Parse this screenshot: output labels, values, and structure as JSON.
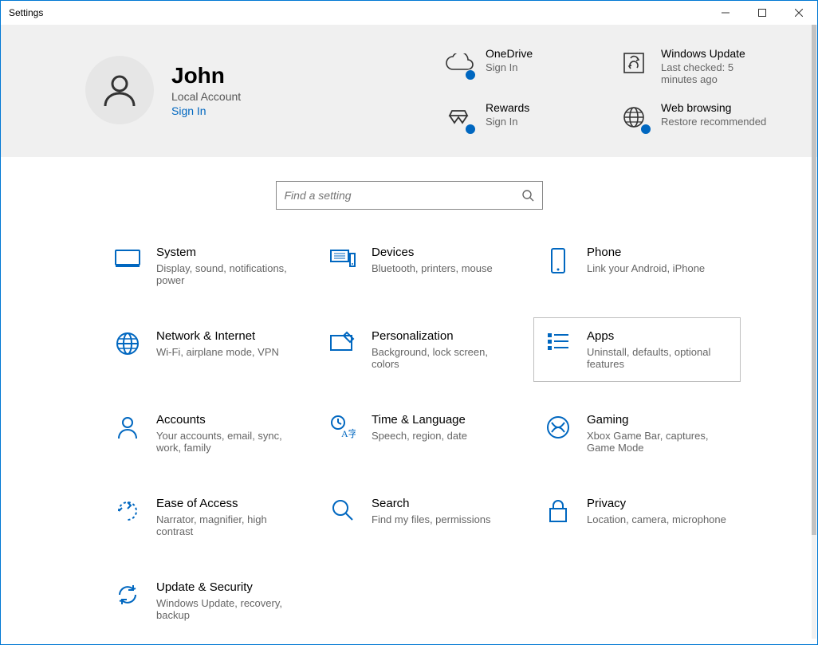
{
  "window": {
    "title": "Settings"
  },
  "account": {
    "name": "John",
    "type": "Local Account",
    "signin": "Sign In"
  },
  "header_tiles": {
    "onedrive": {
      "title": "OneDrive",
      "sub": "Sign In"
    },
    "rewards": {
      "title": "Rewards",
      "sub": "Sign In"
    },
    "windows_update": {
      "title": "Windows Update",
      "sub": "Last checked: 5 minutes ago"
    },
    "web_browsing": {
      "title": "Web browsing",
      "sub": "Restore recommended"
    }
  },
  "search": {
    "placeholder": "Find a setting"
  },
  "categories": {
    "system": {
      "title": "System",
      "desc": "Display, sound, notifications, power"
    },
    "devices": {
      "title": "Devices",
      "desc": "Bluetooth, printers, mouse"
    },
    "phone": {
      "title": "Phone",
      "desc": "Link your Android, iPhone"
    },
    "network": {
      "title": "Network & Internet",
      "desc": "Wi-Fi, airplane mode, VPN"
    },
    "personalization": {
      "title": "Personalization",
      "desc": "Background, lock screen, colors"
    },
    "apps": {
      "title": "Apps",
      "desc": "Uninstall, defaults, optional features"
    },
    "accounts": {
      "title": "Accounts",
      "desc": "Your accounts, email, sync, work, family"
    },
    "time": {
      "title": "Time & Language",
      "desc": "Speech, region, date"
    },
    "gaming": {
      "title": "Gaming",
      "desc": "Xbox Game Bar, captures, Game Mode"
    },
    "ease": {
      "title": "Ease of Access",
      "desc": "Narrator, magnifier, high contrast"
    },
    "search_cat": {
      "title": "Search",
      "desc": "Find my files, permissions"
    },
    "privacy": {
      "title": "Privacy",
      "desc": "Location, camera, microphone"
    },
    "update": {
      "title": "Update & Security",
      "desc": "Windows Update, recovery, backup"
    }
  }
}
